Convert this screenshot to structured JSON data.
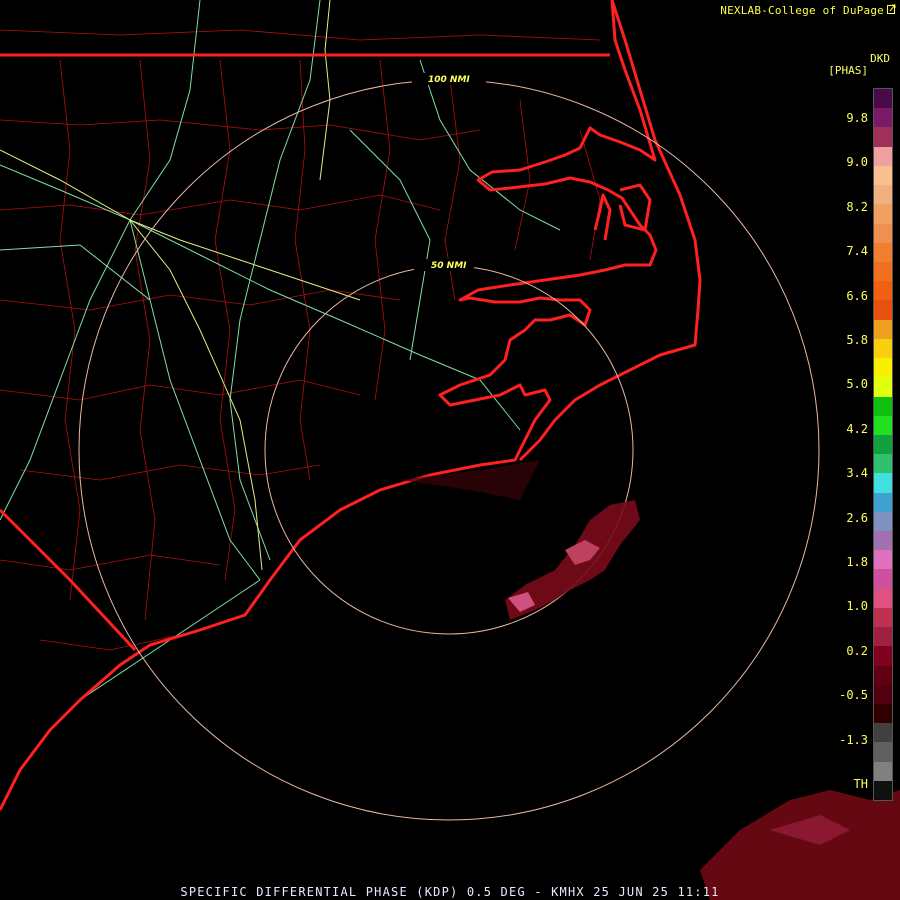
{
  "credit": "NEXLAB-College of DuPage",
  "units": {
    "code": "DKD",
    "unit": "[PHAS]"
  },
  "footer": "SPECIFIC DIFFERENTIAL PHASE (KDP) 0.5 DEG - KMHX 25 JUN 25 11:11",
  "range_rings": [
    "100 NMI",
    "50 NMI"
  ],
  "legend": {
    "labels": [
      "9.8",
      "9.0",
      "8.2",
      "7.4",
      "6.6",
      "5.8",
      "5.0",
      "4.2",
      "3.4",
      "2.6",
      "1.8",
      "1.0",
      "0.2",
      "-0.5",
      "-1.3",
      "TH"
    ],
    "colors": [
      "#4a0a4a",
      "#7a1a6a",
      "#a0305a",
      "#f0a0a0",
      "#f8c090",
      "#f0b080",
      "#f0a060",
      "#f09050",
      "#f08030",
      "#f07020",
      "#f06010",
      "#e85010",
      "#f0a020",
      "#f8d010",
      "#f8f000",
      "#e0ff10",
      "#10c010",
      "#20e020",
      "#10a040",
      "#30c070",
      "#40e0e0",
      "#40a0d0",
      "#8090c0",
      "#a070b0",
      "#e070c0",
      "#d050a0",
      "#e05080",
      "#c03050",
      "#a02040",
      "#800020",
      "#600010",
      "#500010",
      "#300000",
      "#404040",
      "#606060",
      "#808080",
      "#101010"
    ]
  }
}
